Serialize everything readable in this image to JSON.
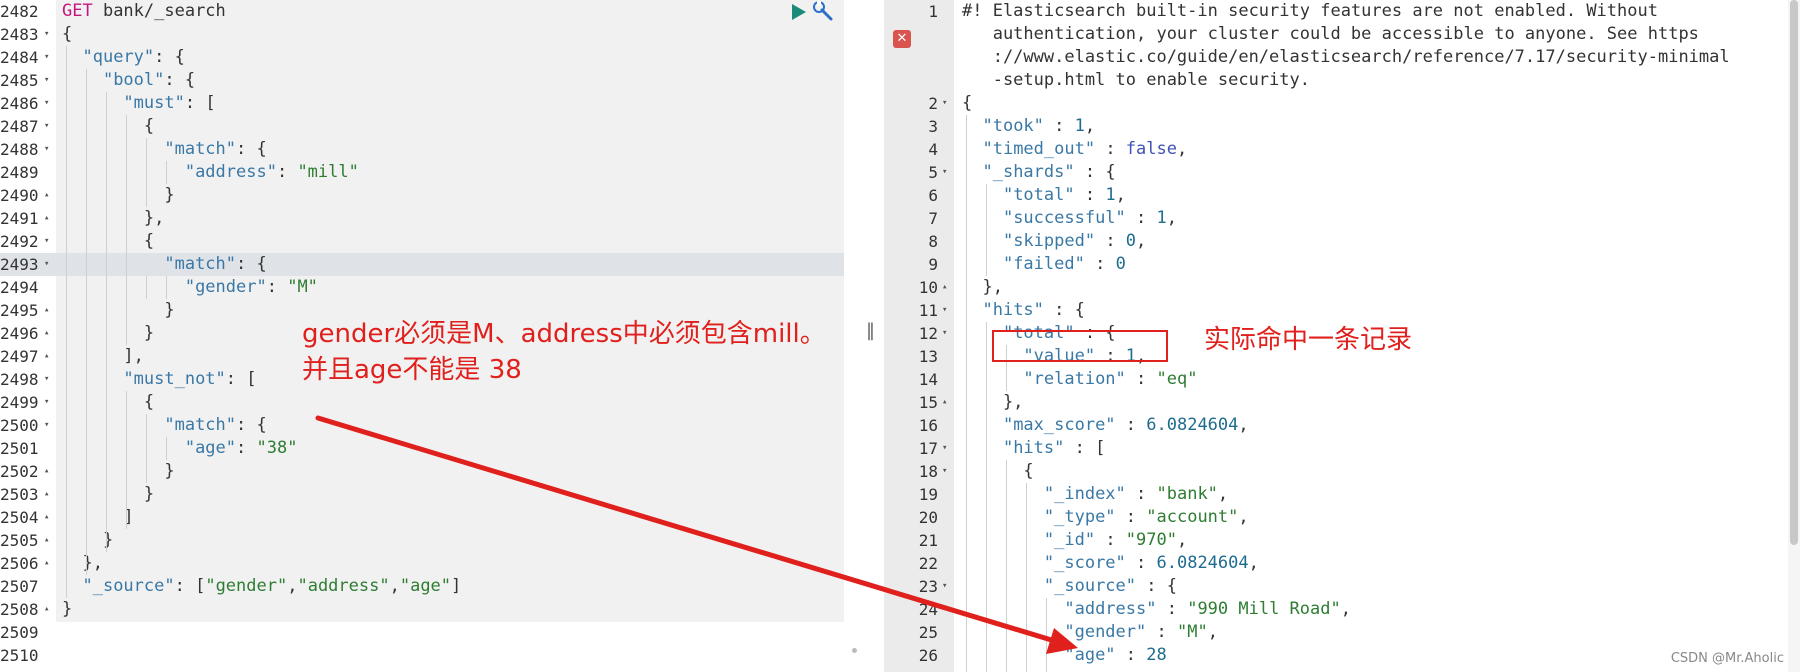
{
  "left_editor": {
    "request_method": "GET",
    "request_path": " bank/_search",
    "lines": [
      {
        "n": "2482",
        "fold": "",
        "parts": []
      },
      {
        "n": "2483",
        "fold": "▾",
        "parts": [
          [
            "p",
            "{"
          ]
        ]
      },
      {
        "n": "2484",
        "fold": "▾",
        "parts": [
          [
            "p",
            "  "
          ],
          [
            "key",
            "\"query\""
          ],
          [
            "p",
            ": {"
          ]
        ]
      },
      {
        "n": "2485",
        "fold": "▾",
        "parts": [
          [
            "p",
            "    "
          ],
          [
            "key",
            "\"bool\""
          ],
          [
            "p",
            ": {"
          ]
        ]
      },
      {
        "n": "2486",
        "fold": "▾",
        "parts": [
          [
            "p",
            "      "
          ],
          [
            "key",
            "\"must\""
          ],
          [
            "p",
            ": ["
          ]
        ]
      },
      {
        "n": "2487",
        "fold": "▾",
        "parts": [
          [
            "p",
            "        {"
          ]
        ]
      },
      {
        "n": "2488",
        "fold": "▾",
        "parts": [
          [
            "p",
            "          "
          ],
          [
            "key",
            "\"match\""
          ],
          [
            "p",
            ": {"
          ]
        ]
      },
      {
        "n": "2489",
        "fold": "",
        "parts": [
          [
            "p",
            "            "
          ],
          [
            "key",
            "\"address\""
          ],
          [
            "p",
            ": "
          ],
          [
            "str",
            "\"mill\""
          ]
        ]
      },
      {
        "n": "2490",
        "fold": "▴",
        "parts": [
          [
            "p",
            "          }"
          ]
        ]
      },
      {
        "n": "2491",
        "fold": "▴",
        "parts": [
          [
            "p",
            "        },"
          ]
        ]
      },
      {
        "n": "2492",
        "fold": "▾",
        "parts": [
          [
            "p",
            "        {"
          ]
        ]
      },
      {
        "n": "2493",
        "fold": "▾",
        "parts": [
          [
            "p",
            "          "
          ],
          [
            "key",
            "\"match\""
          ],
          [
            "p",
            ": {"
          ]
        ]
      },
      {
        "n": "2494",
        "fold": "",
        "parts": [
          [
            "p",
            "            "
          ],
          [
            "key",
            "\"gender\""
          ],
          [
            "p",
            ": "
          ],
          [
            "str",
            "\"M\""
          ]
        ]
      },
      {
        "n": "2495",
        "fold": "▴",
        "parts": [
          [
            "p",
            "          }"
          ]
        ]
      },
      {
        "n": "2496",
        "fold": "▴",
        "parts": [
          [
            "p",
            "        }"
          ]
        ]
      },
      {
        "n": "2497",
        "fold": "▴",
        "parts": [
          [
            "p",
            "      ],"
          ]
        ]
      },
      {
        "n": "2498",
        "fold": "▾",
        "parts": [
          [
            "p",
            "      "
          ],
          [
            "key",
            "\"must_not\""
          ],
          [
            "p",
            ": ["
          ]
        ]
      },
      {
        "n": "2499",
        "fold": "▾",
        "parts": [
          [
            "p",
            "        {"
          ]
        ]
      },
      {
        "n": "2500",
        "fold": "▾",
        "parts": [
          [
            "p",
            "          "
          ],
          [
            "key",
            "\"match\""
          ],
          [
            "p",
            ": {"
          ]
        ]
      },
      {
        "n": "2501",
        "fold": "",
        "parts": [
          [
            "p",
            "            "
          ],
          [
            "key",
            "\"age\""
          ],
          [
            "p",
            ": "
          ],
          [
            "str",
            "\"38\""
          ]
        ]
      },
      {
        "n": "2502",
        "fold": "▴",
        "parts": [
          [
            "p",
            "          }"
          ]
        ]
      },
      {
        "n": "2503",
        "fold": "▴",
        "parts": [
          [
            "p",
            "        }"
          ]
        ]
      },
      {
        "n": "2504",
        "fold": "▴",
        "parts": [
          [
            "p",
            "      ]"
          ]
        ]
      },
      {
        "n": "2505",
        "fold": "▴",
        "parts": [
          [
            "p",
            "    }"
          ]
        ]
      },
      {
        "n": "2506",
        "fold": "▴",
        "parts": [
          [
            "p",
            "  },"
          ]
        ]
      },
      {
        "n": "2507",
        "fold": "",
        "parts": [
          [
            "p",
            "  "
          ],
          [
            "key",
            "\"_source\""
          ],
          [
            "p",
            ": ["
          ],
          [
            "str",
            "\"gender\""
          ],
          [
            "p",
            ","
          ],
          [
            "str",
            "\"address\""
          ],
          [
            "p",
            ","
          ],
          [
            "str",
            "\"age\""
          ],
          [
            "p",
            "]"
          ]
        ]
      },
      {
        "n": "2508",
        "fold": "▴",
        "parts": [
          [
            "p",
            "}"
          ]
        ]
      },
      {
        "n": "2509",
        "fold": "",
        "parts": []
      },
      {
        "n": "2510",
        "fold": "",
        "parts": []
      }
    ]
  },
  "right_editor": {
    "warning_lines": [
      "#! Elasticsearch built-in security features are not enabled. Without",
      "   authentication, your cluster could be accessible to anyone. See https",
      "   ://www.elastic.co/guide/en/elasticsearch/reference/7.17/security-minimal",
      "   -setup.html to enable security."
    ],
    "lines": [
      {
        "n": "2",
        "fold": "▾",
        "parts": [
          [
            "p",
            "{"
          ]
        ]
      },
      {
        "n": "3",
        "fold": "",
        "parts": [
          [
            "p",
            "  "
          ],
          [
            "key",
            "\"took\""
          ],
          [
            "p",
            " : "
          ],
          [
            "num",
            "1"
          ],
          [
            "p",
            ","
          ]
        ]
      },
      {
        "n": "4",
        "fold": "",
        "parts": [
          [
            "p",
            "  "
          ],
          [
            "key",
            "\"timed_out\""
          ],
          [
            "p",
            " : "
          ],
          [
            "bool",
            "false"
          ],
          [
            "p",
            ","
          ]
        ]
      },
      {
        "n": "5",
        "fold": "▾",
        "parts": [
          [
            "p",
            "  "
          ],
          [
            "key",
            "\"_shards\""
          ],
          [
            "p",
            " : {"
          ]
        ]
      },
      {
        "n": "6",
        "fold": "",
        "parts": [
          [
            "p",
            "    "
          ],
          [
            "key",
            "\"total\""
          ],
          [
            "p",
            " : "
          ],
          [
            "num",
            "1"
          ],
          [
            "p",
            ","
          ]
        ]
      },
      {
        "n": "7",
        "fold": "",
        "parts": [
          [
            "p",
            "    "
          ],
          [
            "key",
            "\"successful\""
          ],
          [
            "p",
            " : "
          ],
          [
            "num",
            "1"
          ],
          [
            "p",
            ","
          ]
        ]
      },
      {
        "n": "8",
        "fold": "",
        "parts": [
          [
            "p",
            "    "
          ],
          [
            "key",
            "\"skipped\""
          ],
          [
            "p",
            " : "
          ],
          [
            "num",
            "0"
          ],
          [
            "p",
            ","
          ]
        ]
      },
      {
        "n": "9",
        "fold": "",
        "parts": [
          [
            "p",
            "    "
          ],
          [
            "key",
            "\"failed\""
          ],
          [
            "p",
            " : "
          ],
          [
            "num",
            "0"
          ]
        ]
      },
      {
        "n": "10",
        "fold": "▴",
        "parts": [
          [
            "p",
            "  },"
          ]
        ]
      },
      {
        "n": "11",
        "fold": "▾",
        "parts": [
          [
            "p",
            "  "
          ],
          [
            "key",
            "\"hits\""
          ],
          [
            "p",
            " : {"
          ]
        ]
      },
      {
        "n": "12",
        "fold": "▾",
        "parts": [
          [
            "p",
            "    "
          ],
          [
            "key",
            "\"total\""
          ],
          [
            "p",
            " : {"
          ]
        ]
      },
      {
        "n": "13",
        "fold": "",
        "parts": [
          [
            "p",
            "      "
          ],
          [
            "key",
            "\"value\""
          ],
          [
            "p",
            " : "
          ],
          [
            "num",
            "1"
          ],
          [
            "p",
            ","
          ]
        ]
      },
      {
        "n": "14",
        "fold": "",
        "parts": [
          [
            "p",
            "      "
          ],
          [
            "key",
            "\"relation\""
          ],
          [
            "p",
            " : "
          ],
          [
            "str",
            "\"eq\""
          ]
        ]
      },
      {
        "n": "15",
        "fold": "▴",
        "parts": [
          [
            "p",
            "    },"
          ]
        ]
      },
      {
        "n": "16",
        "fold": "",
        "parts": [
          [
            "p",
            "    "
          ],
          [
            "key",
            "\"max_score\""
          ],
          [
            "p",
            " : "
          ],
          [
            "num",
            "6.0824604"
          ],
          [
            "p",
            ","
          ]
        ]
      },
      {
        "n": "17",
        "fold": "▾",
        "parts": [
          [
            "p",
            "    "
          ],
          [
            "key",
            "\"hits\""
          ],
          [
            "p",
            " : ["
          ]
        ]
      },
      {
        "n": "18",
        "fold": "▾",
        "parts": [
          [
            "p",
            "      {"
          ]
        ]
      },
      {
        "n": "19",
        "fold": "",
        "parts": [
          [
            "p",
            "        "
          ],
          [
            "key",
            "\"_index\""
          ],
          [
            "p",
            " : "
          ],
          [
            "str",
            "\"bank\""
          ],
          [
            "p",
            ","
          ]
        ]
      },
      {
        "n": "20",
        "fold": "",
        "parts": [
          [
            "p",
            "        "
          ],
          [
            "key",
            "\"_type\""
          ],
          [
            "p",
            " : "
          ],
          [
            "str",
            "\"account\""
          ],
          [
            "p",
            ","
          ]
        ]
      },
      {
        "n": "21",
        "fold": "",
        "parts": [
          [
            "p",
            "        "
          ],
          [
            "key",
            "\"_id\""
          ],
          [
            "p",
            " : "
          ],
          [
            "str",
            "\"970\""
          ],
          [
            "p",
            ","
          ]
        ]
      },
      {
        "n": "22",
        "fold": "",
        "parts": [
          [
            "p",
            "        "
          ],
          [
            "key",
            "\"_score\""
          ],
          [
            "p",
            " : "
          ],
          [
            "num",
            "6.0824604"
          ],
          [
            "p",
            ","
          ]
        ]
      },
      {
        "n": "23",
        "fold": "▾",
        "parts": [
          [
            "p",
            "        "
          ],
          [
            "key",
            "\"_source\""
          ],
          [
            "p",
            " : {"
          ]
        ]
      },
      {
        "n": "24",
        "fold": "",
        "parts": [
          [
            "p",
            "          "
          ],
          [
            "key",
            "\"address\""
          ],
          [
            "p",
            " : "
          ],
          [
            "str",
            "\"990 Mill Road\""
          ],
          [
            "p",
            ","
          ]
        ]
      },
      {
        "n": "25",
        "fold": "",
        "parts": [
          [
            "p",
            "          "
          ],
          [
            "key",
            "\"gender\""
          ],
          [
            "p",
            " : "
          ],
          [
            "str",
            "\"M\""
          ],
          [
            "p",
            ","
          ]
        ]
      },
      {
        "n": "26",
        "fold": "",
        "parts": [
          [
            "p",
            "          "
          ],
          [
            "key",
            "\"age\""
          ],
          [
            "p",
            " : "
          ],
          [
            "num",
            "28"
          ]
        ]
      }
    ]
  },
  "annotations": {
    "left_line1": "gender必须是M、address中必须包含mill。",
    "left_line2": "并且age不能是 38",
    "right_note": "实际命中一条记录",
    "arrow_color": "#e0201c"
  },
  "icons": {
    "run": "play-icon",
    "settings": "wrench-icon",
    "error": "error-x-icon",
    "divider": "resize-handle-icon"
  },
  "watermark": "CSDN @Mr.Aholic"
}
